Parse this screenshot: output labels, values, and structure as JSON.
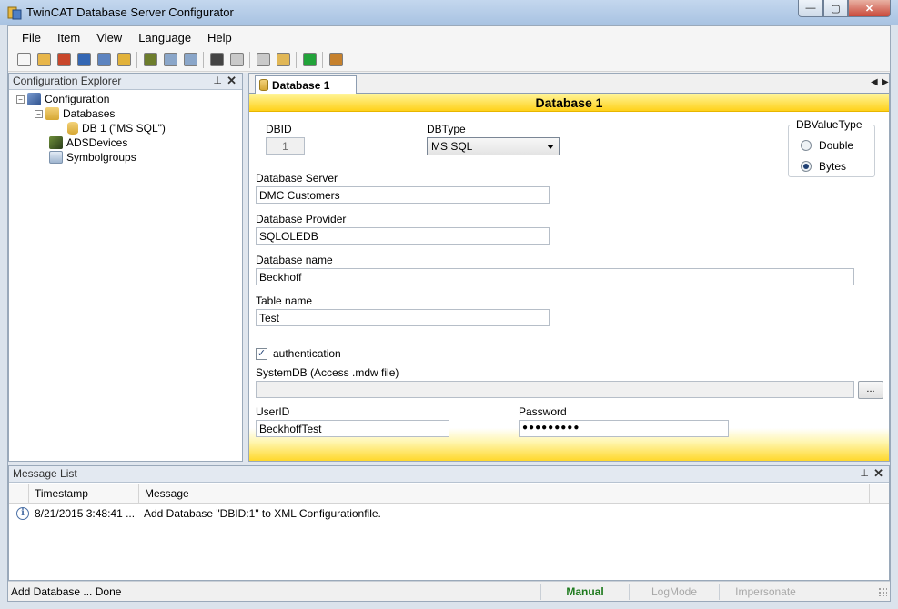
{
  "window": {
    "title": "TwinCAT Database Server Configurator",
    "min_glyph": "—",
    "max_glyph": "▢",
    "close_glyph": "✕"
  },
  "menu": [
    "File",
    "Item",
    "View",
    "Language",
    "Help"
  ],
  "toolbar": {
    "buttons": [
      {
        "icon": "new-icon",
        "color": "#f6f6f6"
      },
      {
        "icon": "open-icon",
        "color": "#e8b64a"
      },
      {
        "icon": "open-red-icon",
        "color": "#c9472b"
      },
      {
        "icon": "save-icon",
        "color": "#3467b4"
      },
      {
        "icon": "save-as-icon",
        "color": "#5d84c0"
      },
      {
        "icon": "add-database-icon",
        "color": "#e2b23a"
      },
      {
        "icon": "add-ads-device-icon",
        "color": "#6d7d2c"
      },
      {
        "icon": "add-symbol-icon",
        "color": "#8aa6c9"
      },
      {
        "icon": "copy-icon",
        "color": "#8aa6c9"
      },
      {
        "icon": "delete-icon",
        "color": "#444444"
      },
      {
        "icon": "import-icon",
        "color": "#c9c9c9"
      },
      {
        "icon": "search-icon",
        "color": "#c9c9c9"
      },
      {
        "icon": "paste-icon",
        "color": "#e1b756"
      },
      {
        "icon": "run-icon",
        "color": "#22a33a"
      },
      {
        "icon": "report-icon",
        "color": "#c6812d"
      }
    ]
  },
  "explorer": {
    "title": "Configuration Explorer",
    "pin_glyph": "⊥",
    "close_glyph": "✕",
    "expander_minus": "−",
    "tree": {
      "root": "Configuration",
      "databases": "Databases",
      "db1": "DB 1 (\"MS SQL\")",
      "ads_devices": "ADSDevices",
      "symbolgroups": "Symbolgroups"
    }
  },
  "document": {
    "tab_label": "Database 1",
    "nav_left": "◀",
    "nav_right": "▶",
    "banner_title": "Database 1",
    "form": {
      "dbid_label": "DBID",
      "dbid_value": "1",
      "dbtype_label": "DBType",
      "dbtype_value": "MS SQL",
      "dbvaluetype_label": "DBValueType",
      "radio_double": "Double",
      "radio_bytes": "Bytes",
      "server_label": "Database Server",
      "server_value": "DMC Customers",
      "provider_label": "Database Provider",
      "provider_value": "SQLOLEDB",
      "name_label": "Database name",
      "name_value": "Beckhoff",
      "table_label": "Table name",
      "table_value": "Test",
      "auth_label": "authentication",
      "auth_check_glyph": "✓",
      "systemdb_label": "SystemDB (Access .mdw file)",
      "systemdb_value": "",
      "browse_label": "...",
      "userid_label": "UserID",
      "userid_value": "BeckhoffTest",
      "password_label": "Password",
      "password_value": "●●●●●●●●●"
    }
  },
  "messages": {
    "title": "Message List",
    "pin_glyph": "⊥",
    "close_glyph": "✕",
    "columns": [
      "Timestamp",
      "Message"
    ],
    "info_glyph": "i",
    "rows": [
      {
        "timestamp": "8/21/2015 3:48:41 ...",
        "message": "Add Database \"DBID:1\" to XML Configurationfile."
      }
    ]
  },
  "status": {
    "text": "Add Database ... Done",
    "mode": "Manual",
    "logmode": "LogMode",
    "impersonate": "Impersonate",
    "mode_color": "#1e7a1e",
    "disabled_color": "#a8a8a8"
  },
  "colors": {
    "banner_yellow": "#ffd11a",
    "titlebar_blue": "#a9c3e2"
  }
}
